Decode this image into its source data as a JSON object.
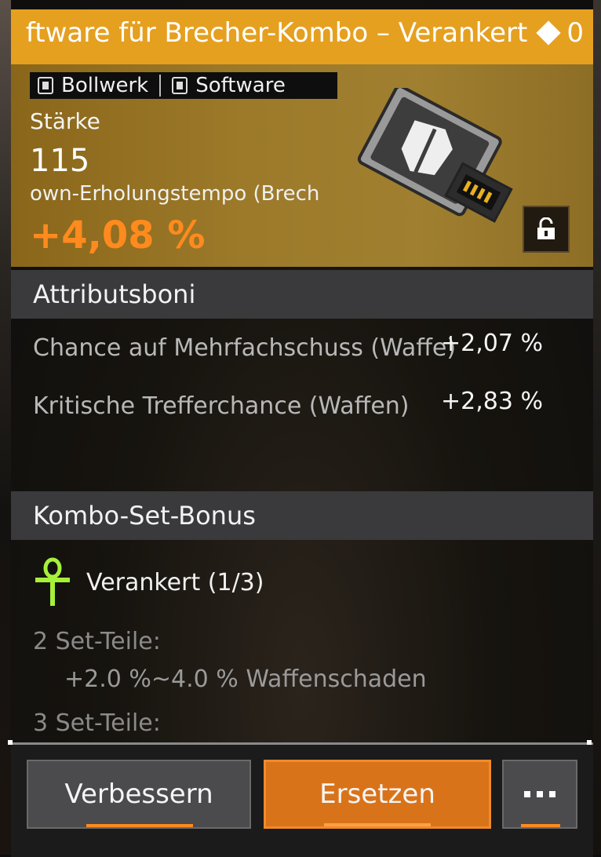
{
  "title": {
    "text": "ftware für Brecher-Kombo – Verankert",
    "count": "0"
  },
  "tags": [
    {
      "icon": "shield-emblem-icon",
      "label": "Bollwerk"
    },
    {
      "icon": "software-card-icon",
      "label": "Software"
    }
  ],
  "header": {
    "stat_label": "Stärke",
    "stat_value": "115",
    "sub_label": "own-Erholungstempo (Brech",
    "sub_value": "+4,08 %"
  },
  "attributes": {
    "heading": "Attributsboni",
    "items": [
      {
        "name": "Chance auf Mehrfachschuss (Waffe)",
        "value": "+2,07 %"
      },
      {
        "name": "Kritische Trefferchance (Waffen)",
        "value": "+2,83 %"
      }
    ]
  },
  "set_bonus": {
    "heading": "Kombo-Set-Bonus",
    "set_name": "Verankert (1/3)",
    "tiers": [
      {
        "label": "2 Set-Teile:",
        "effect": "+2.0 %~4.0 % Waffenschaden"
      },
      {
        "label": "3 Set-Teile:"
      }
    ]
  },
  "buttons": {
    "upgrade": "Verbessern",
    "replace": "Ersetzen"
  },
  "colors": {
    "title_bar": "#e5a020",
    "accent_orange": "#ff8a1e",
    "ankh_green": "#a6f03a"
  }
}
